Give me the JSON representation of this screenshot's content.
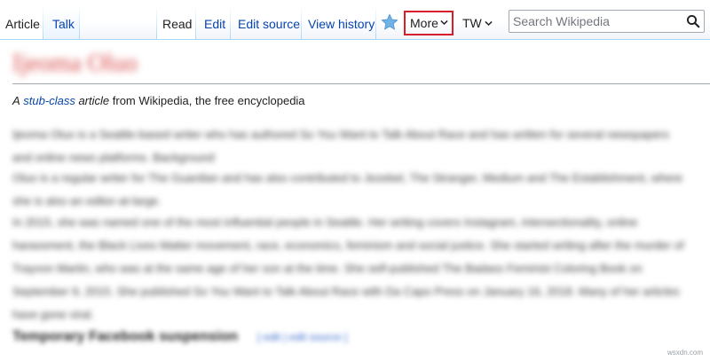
{
  "tabs": {
    "article": "Article",
    "talk": "Talk",
    "read": "Read",
    "edit": "Edit",
    "edit_source": "Edit source",
    "view_history": "View history",
    "more": "More",
    "tw": "TW"
  },
  "search": {
    "placeholder": "Search Wikipedia"
  },
  "colors": {
    "link": "#0645ad",
    "highlight_border": "#d81e2a",
    "tab_border": "#a7d7f9",
    "star": "#6fb2e6"
  },
  "icons": {
    "watch": "star-icon",
    "search": "search-icon",
    "dropdown": "chevron-down-icon"
  },
  "article": {
    "title": "Ijeoma Oluo",
    "tagline_a": "A",
    "tagline_stub": "stub-class",
    "tagline_article": "article",
    "tagline_rest": "from Wikipedia, the free encyclopedia",
    "para1": "Ijeoma Oluo is a Seattle-based writer who has authored So You Want to Talk About Race and has written for several newspapers and online news platforms. Background",
    "para2": "Oluo is a regular writer for The Guardian and has also contributed to Jezebel, The Stranger, Medium and The Establishment, where she is also an editor-at-large.",
    "para3": "In 2015, she was named one of the most influential people in Seattle. Her writing covers Instagram, intersectionality, online harassment, the Black Lives Matter movement, race, economics, feminism and social justice. She started writing after the murder of Trayvon Martin, who was at the same age of her son at the time. She self-published The Badass Feminist Coloring Book on September 9, 2015. She published So You Want to Talk About Race with Da Capo Press on January 16, 2018. Many of her articles have gone viral.",
    "section_heading": "Temporary Facebook suspension",
    "section_edit": "[ edit | edit source ]"
  },
  "watermark": "wsxdn.com"
}
